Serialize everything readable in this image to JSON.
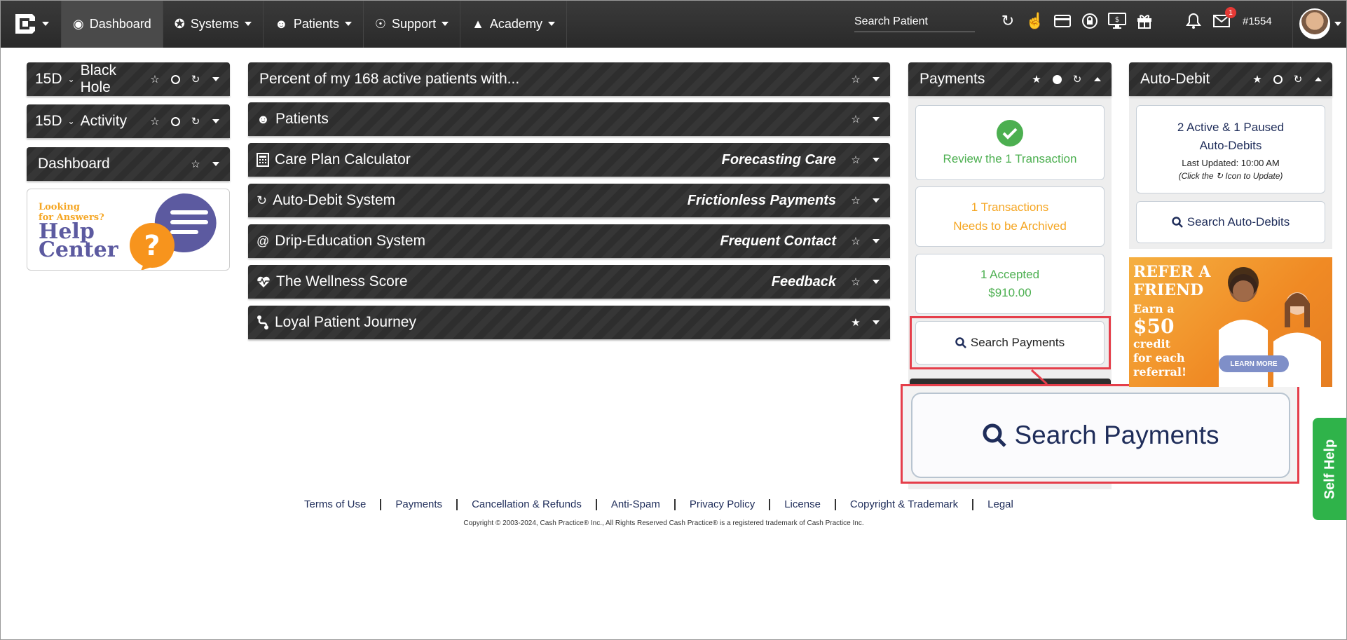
{
  "navbar": {
    "items": [
      {
        "label": "Dashboard",
        "icon": "dashboard-icon"
      },
      {
        "label": "Systems",
        "icon": "puzzle-icon"
      },
      {
        "label": "Patients",
        "icon": "users-icon"
      },
      {
        "label": "Support",
        "icon": "lifebuoy-icon"
      },
      {
        "label": "Academy",
        "icon": "graduation-cap-icon"
      }
    ],
    "search_placeholder": "Search Patient",
    "notification_badge": "1",
    "account_number": "#1554"
  },
  "left_panels": {
    "black_hole": {
      "range": "15D",
      "label": "Black Hole"
    },
    "activity": {
      "range": "15D",
      "label": "Activity"
    },
    "dashboard": {
      "label": "Dashboard"
    },
    "help": {
      "line1": "Looking",
      "line2": "for Answers?",
      "line3": "Help",
      "line4": "Center"
    }
  },
  "center_panels": [
    {
      "title": "Percent of my 168 active patients with...",
      "subtitle": "",
      "icon": ""
    },
    {
      "title": "Patients",
      "subtitle": "",
      "icon": "users-icon"
    },
    {
      "title": "Care Plan Calculator",
      "subtitle": "Forecasting Care",
      "icon": "calculator-icon"
    },
    {
      "title": "Auto-Debit System",
      "subtitle": "Frictionless Payments",
      "icon": "refresh-icon"
    },
    {
      "title": "Drip-Education System",
      "subtitle": "Frequent Contact",
      "icon": "at-icon"
    },
    {
      "title": "The Wellness Score",
      "subtitle": "Feedback",
      "icon": "heartbeat-icon"
    },
    {
      "title": "Loyal Patient Journey",
      "subtitle": "",
      "icon": "route-icon"
    }
  ],
  "payments": {
    "title": "Payments",
    "review": "Review the 1 Transaction",
    "archive_line1": "1 Transactions",
    "archive_line2": "Needs to be Archived",
    "accepted_line1": "1 Accepted",
    "accepted_line2": "$910.00",
    "search_label": "Search Payments",
    "zoom_label": "Search Payments"
  },
  "auto_debit": {
    "title": "Auto-Debit",
    "status_line1": "2 Active & 1 Paused",
    "status_line2": "Auto-Debits",
    "last_updated": "Last Updated: 10:00 AM",
    "hint_pre": "(Click the",
    "hint_post": "Icon to Update)",
    "search_label": "Search Auto-Debits"
  },
  "refer": {
    "line1": "REFER A",
    "line2": "FRIEND",
    "line3": "Earn a",
    "line4": "$50",
    "line5": "credit",
    "line6": "for each",
    "line7": "referral!",
    "button": "LEARN MORE"
  },
  "self_help": "Self Help",
  "footer": {
    "links": [
      "Terms of Use",
      "Payments",
      "Cancellation & Refunds",
      "Anti-Spam",
      "Privacy Policy",
      "License",
      "Copyright & Trademark",
      "Legal"
    ],
    "copyright": "Copyright © 2003-2024, Cash Practice® Inc., All Rights Reserved Cash Practice® is a registered trademark of Cash Practice Inc."
  },
  "colors": {
    "green": "#4caf50",
    "orange": "#f5a623",
    "highlight": "#e53e4a",
    "self_help": "#2fb34a",
    "navy": "#1f2d5a"
  }
}
